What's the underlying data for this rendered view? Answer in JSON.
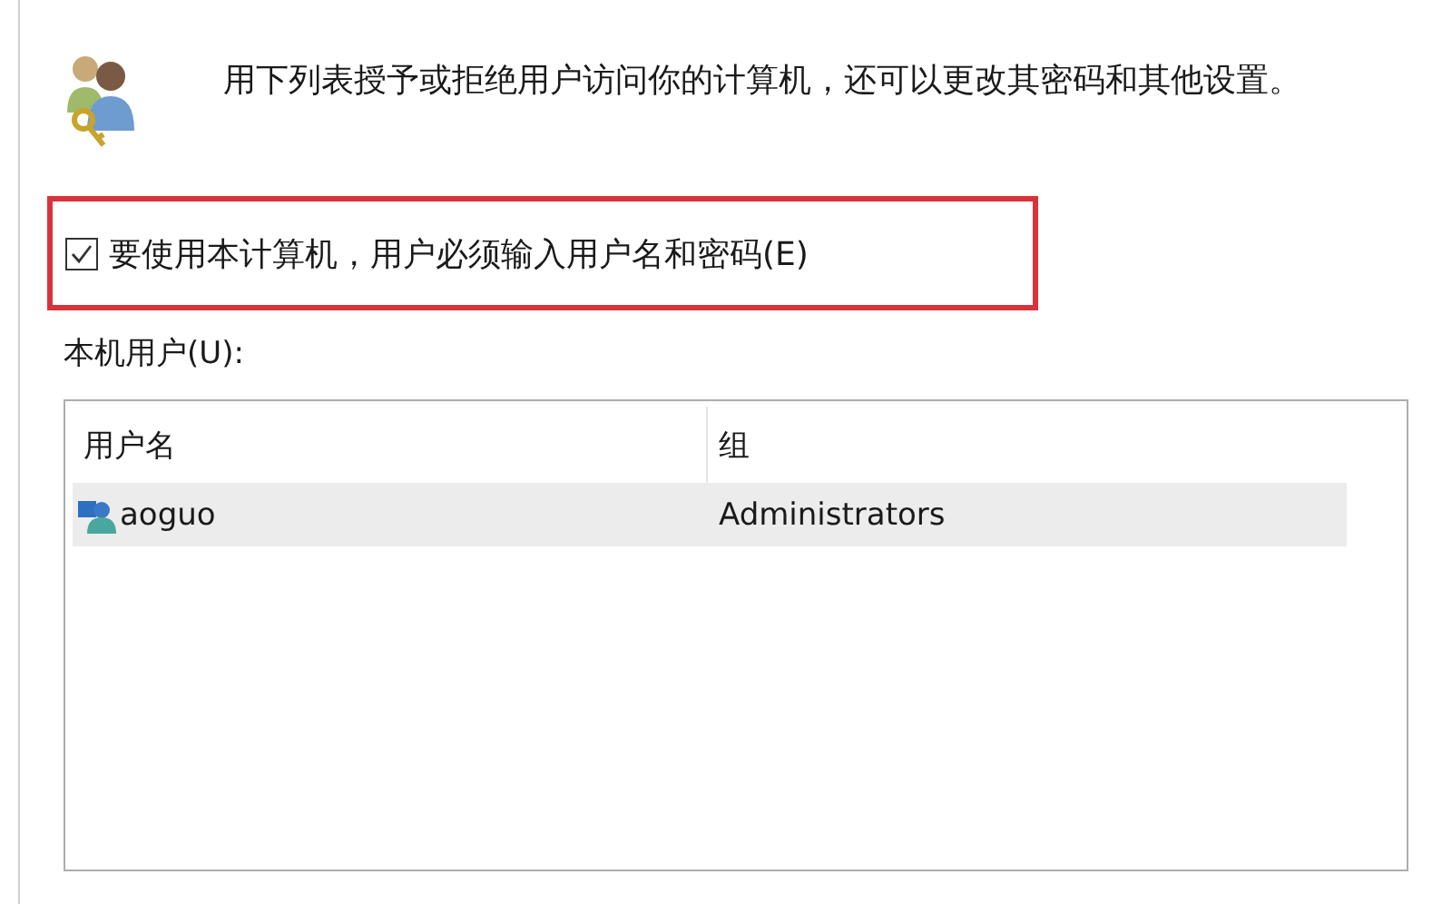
{
  "description": "用下列表授予或拒绝用户访问你的计算机，还可以更改其密码和其他设置。",
  "login_option": {
    "label": "要使用本计算机，用户必须输入用户名和密码(E)",
    "checked": true,
    "highlighted": true
  },
  "users_label": "本机用户(U):",
  "table": {
    "columns": [
      "用户名",
      "组"
    ],
    "rows": [
      {
        "user": "aoguo",
        "group": "Administrators",
        "selected": true
      }
    ]
  }
}
